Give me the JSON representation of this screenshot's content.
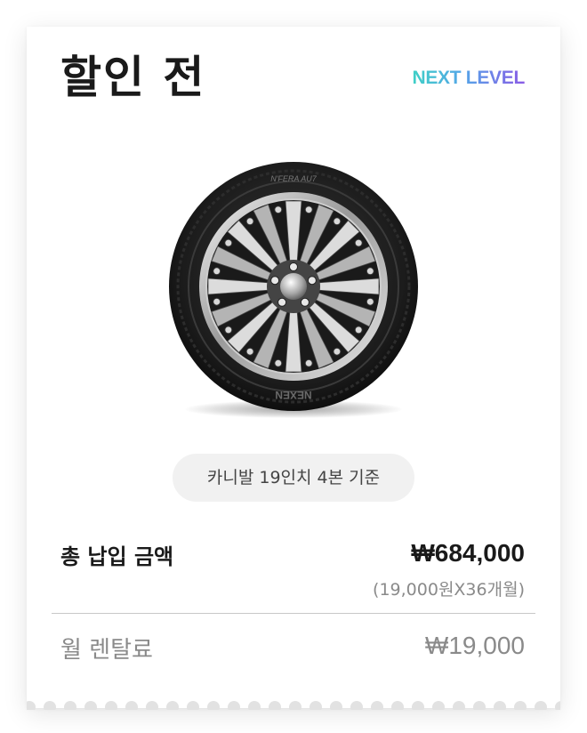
{
  "header": {
    "title": "할인 전",
    "brand": "NEXT LEVEL"
  },
  "product": {
    "image_icon": "tire-icon",
    "tire_sidewall_top": "N'FERA AU7",
    "tire_sidewall_bottom": "NEXEN"
  },
  "criteria": {
    "label": "카니발 19인치 4본 기준"
  },
  "summary": {
    "total_label": "총 납입 금액",
    "total_amount": "₩684,000",
    "total_breakdown": "(19,000원X36개월)",
    "monthly_label": "월 렌탈료",
    "monthly_amount": "₩19,000"
  },
  "colors": {
    "brand_gradient_start": "#3fd0c6",
    "brand_gradient_end": "#8a5be6",
    "text_primary": "#1a1a1a",
    "text_muted": "#8a8a8a",
    "pill_background": "#f1f1f1"
  }
}
